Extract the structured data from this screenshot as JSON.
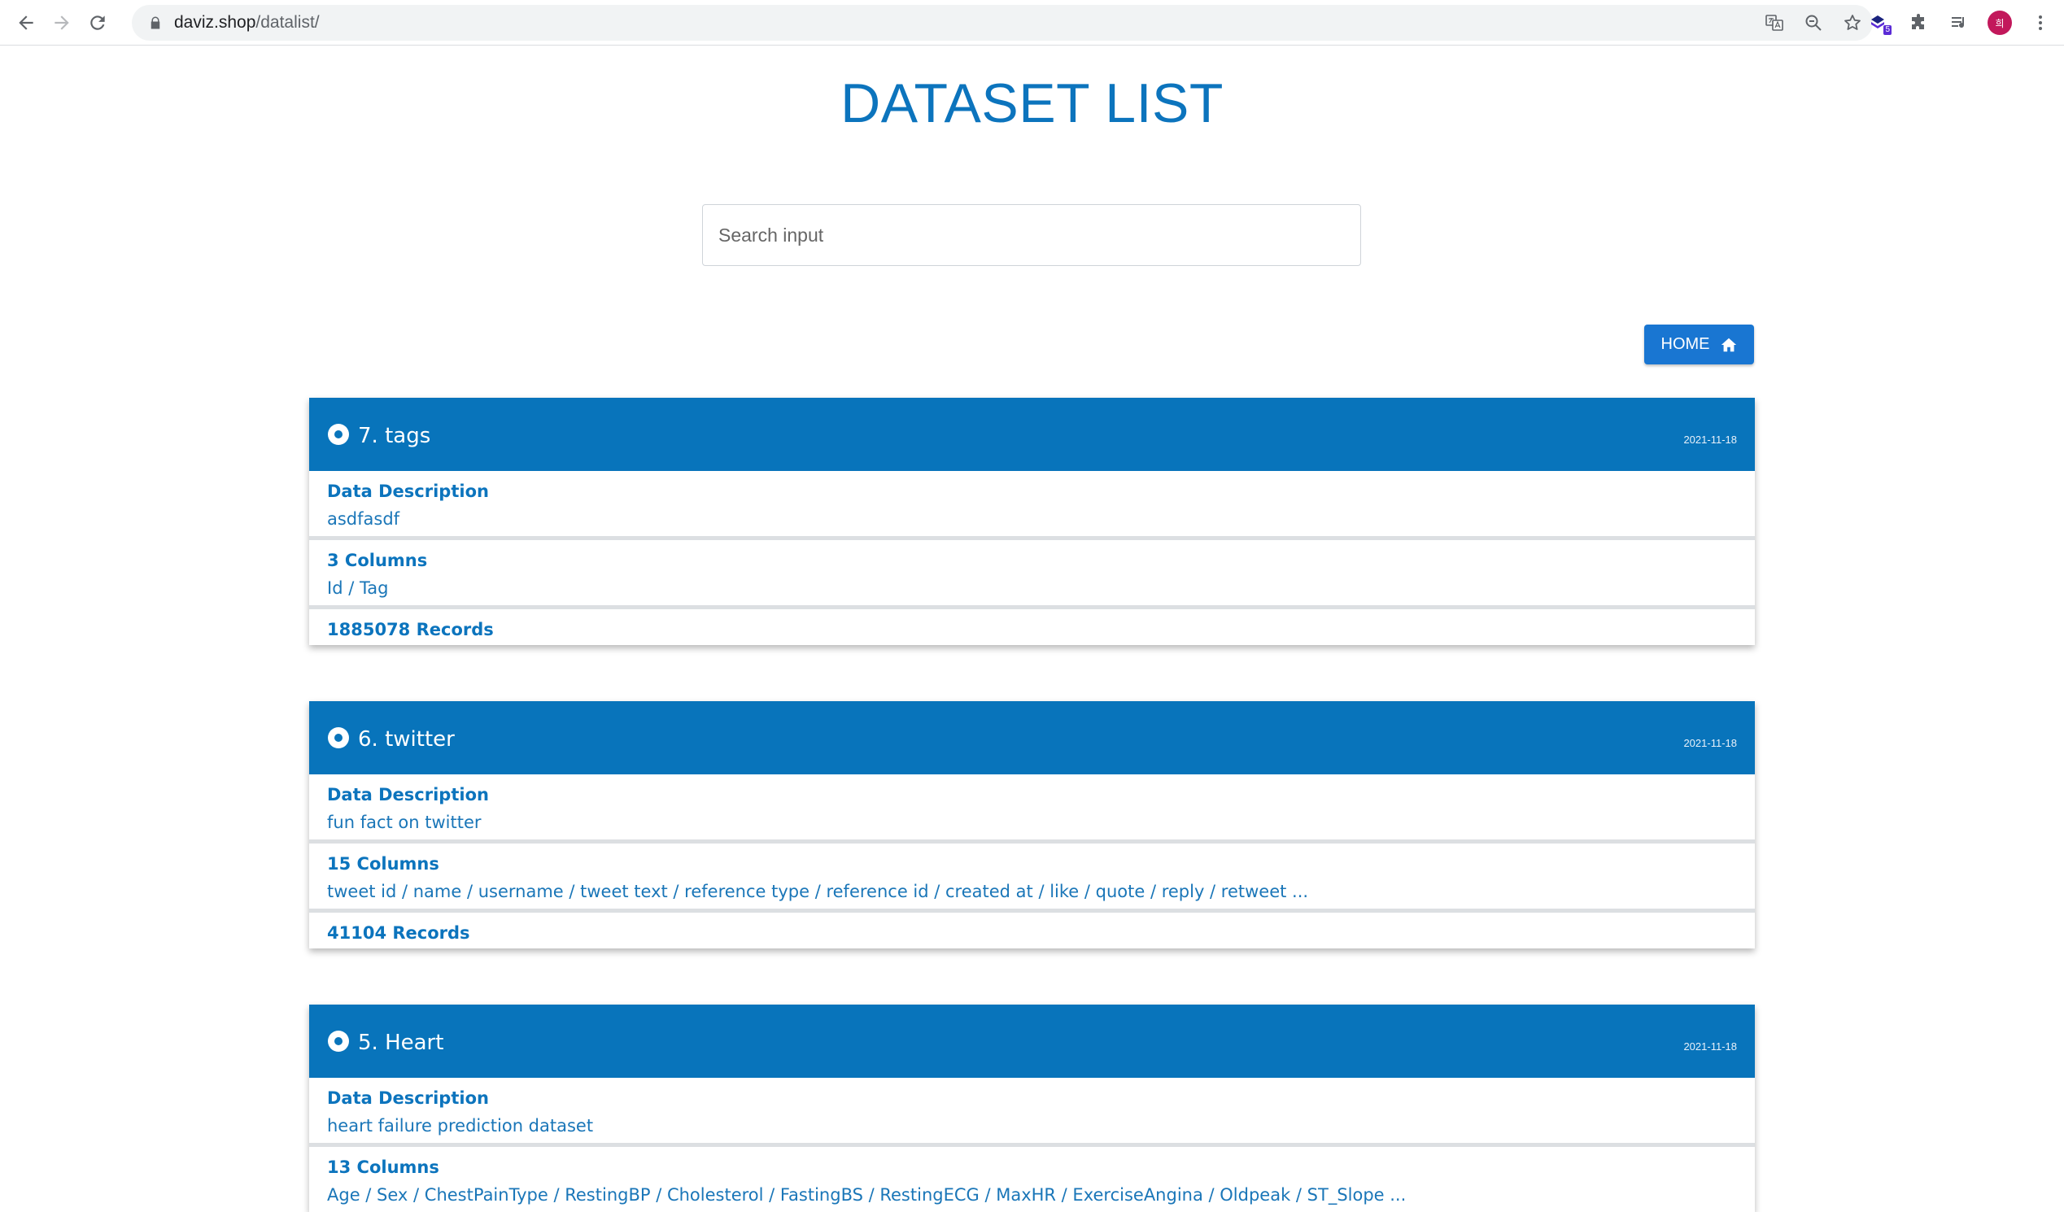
{
  "browser": {
    "url_host": "daviz.shop",
    "url_path": "/datalist/",
    "extension_badge": "5",
    "profile_initial": "희"
  },
  "page": {
    "title": "DATASET LIST",
    "search_placeholder": "Search input",
    "home_label": "HOME"
  },
  "datasets": [
    {
      "title": "7. tags",
      "date": "2021-11-18",
      "desc_label": "Data Description",
      "description": "asdfasdf",
      "columns_label": "3 Columns",
      "columns": "Id / Tag",
      "records": "1885078 Records"
    },
    {
      "title": "6. twitter",
      "date": "2021-11-18",
      "desc_label": "Data Description",
      "description": "fun fact on twitter",
      "columns_label": "15 Columns",
      "columns": "tweet id / name / username / tweet text / reference type / reference id / created at / like / quote / reply / retweet ...",
      "records": "41104 Records"
    },
    {
      "title": "5. Heart",
      "date": "2021-11-18",
      "desc_label": "Data Description",
      "description": "heart failure prediction dataset",
      "columns_label": "13 Columns",
      "columns": "Age / Sex / ChestPainType / RestingBP / Cholesterol / FastingBS / RestingECG / MaxHR / ExerciseAngina / Oldpeak / ST_Slope ..."
    }
  ],
  "colors": {
    "primary": "#0874bb",
    "button": "#1976d2",
    "text_blue": "#0c74bd"
  }
}
